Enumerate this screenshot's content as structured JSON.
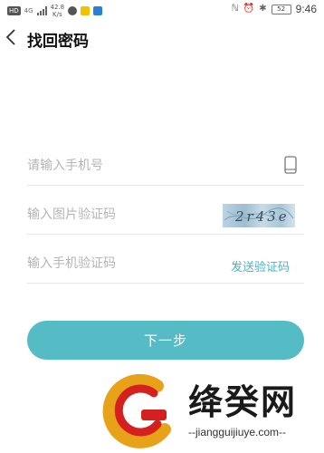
{
  "status_bar": {
    "hd": "HD",
    "network": "4G",
    "speed_value": "42.8",
    "speed_unit": "K/s",
    "battery": "52",
    "time": "9:46"
  },
  "header": {
    "title": "找回密码"
  },
  "form": {
    "phone_placeholder": "请输入手机号",
    "captcha_placeholder": "输入图片验证码",
    "captcha_image_text": "2r43e",
    "sms_placeholder": "输入手机验证码",
    "send_code_label": "发送验证码"
  },
  "next_button": {
    "label": "下一步"
  },
  "watermark": {
    "text": "绛癸网",
    "url": "--jiangguijiuye.com--"
  },
  "colors": {
    "accent": "#55bcc6",
    "link": "#4db3c4",
    "divider": "#e6e6e6",
    "placeholder": "#b5b5b5"
  }
}
